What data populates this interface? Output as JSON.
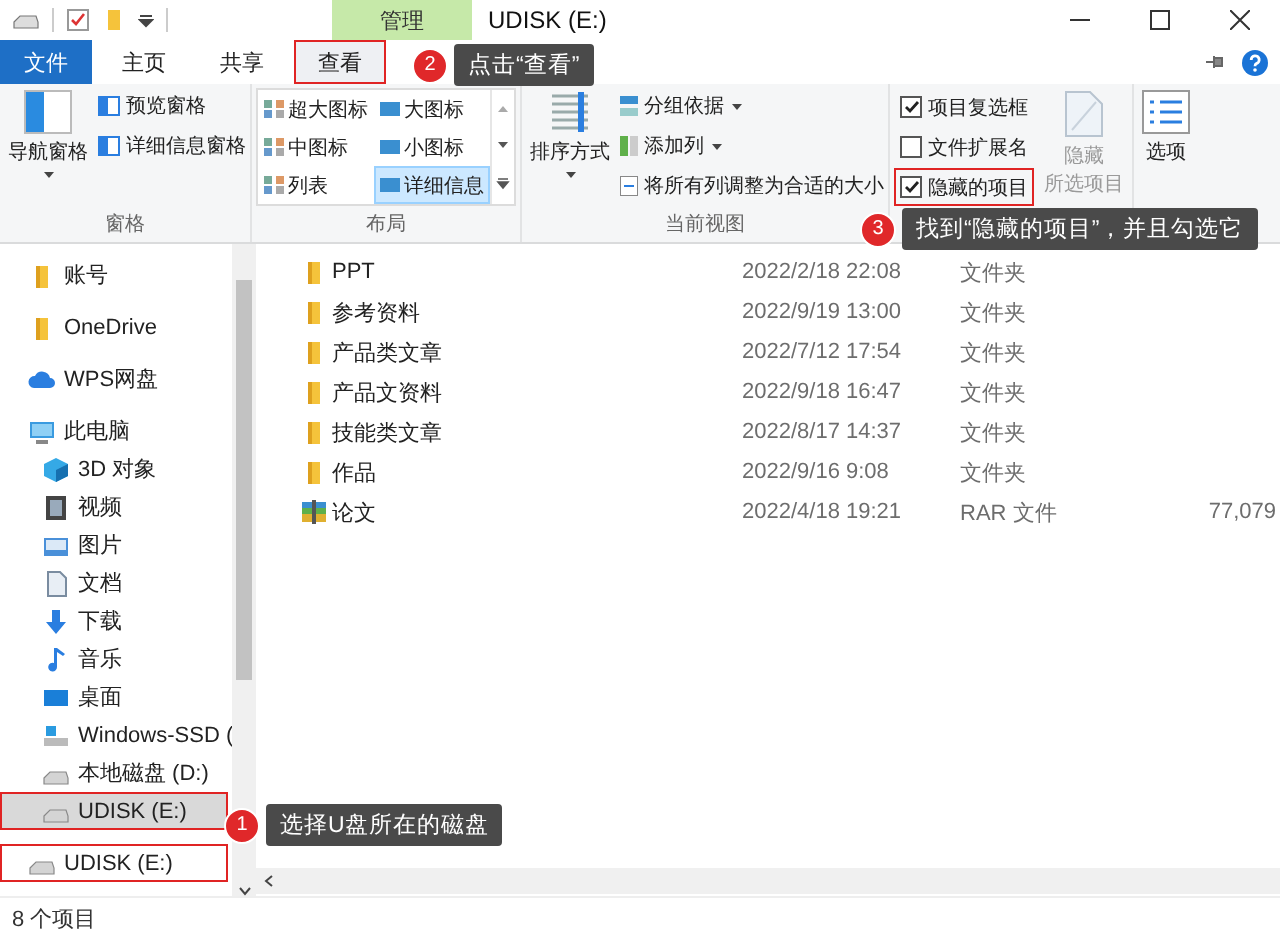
{
  "title_bar": {
    "context_tab": "管理",
    "title": "UDISK (E:)"
  },
  "ribbon_tabs": [
    {
      "label": "文件",
      "kind": "file",
      "selected": false,
      "highlighted": false
    },
    {
      "label": "主页",
      "kind": "tab",
      "selected": false,
      "highlighted": false
    },
    {
      "label": "共享",
      "kind": "tab",
      "selected": false,
      "highlighted": false
    },
    {
      "label": "查看",
      "kind": "tab",
      "selected": true,
      "highlighted": true
    }
  ],
  "ribbon": {
    "panes": {
      "label": "窗格",
      "navigation_pane": "导航窗格",
      "preview_pane": "预览窗格",
      "details_pane": "详细信息窗格"
    },
    "layout": {
      "label": "布局",
      "options": [
        {
          "label": "超大图标",
          "selected": false
        },
        {
          "label": "大图标",
          "selected": false
        },
        {
          "label": "中图标",
          "selected": false
        },
        {
          "label": "小图标",
          "selected": false
        },
        {
          "label": "列表",
          "selected": false
        },
        {
          "label": "详细信息",
          "selected": true
        }
      ]
    },
    "current_view": {
      "label": "当前视图",
      "sort_by": "排序方式",
      "group_by": "分组依据",
      "add_columns": "添加列",
      "size_columns": "将所有列调整为合适的大小"
    },
    "show_hide": {
      "checkboxes": [
        {
          "label": "项目复选框",
          "checked": true,
          "highlighted": false
        },
        {
          "label": "文件扩展名",
          "checked": false,
          "highlighted": false
        },
        {
          "label": "隐藏的项目",
          "checked": true,
          "highlighted": true
        }
      ],
      "hide_selected": {
        "lines": [
          "隐藏",
          "所选项目"
        ],
        "disabled": true
      }
    },
    "options": "选项"
  },
  "navigation": [
    {
      "label": "账号",
      "kind": "folder",
      "selected": false,
      "highlighted": false
    },
    {
      "label": "OneDrive",
      "kind": "folder",
      "selected": false,
      "highlighted": false
    },
    {
      "label": "WPS网盘",
      "kind": "cloud",
      "selected": false,
      "highlighted": false
    },
    {
      "label": "此电脑",
      "kind": "pc",
      "selected": false,
      "highlighted": false,
      "children": [
        {
          "label": "3D 对象",
          "kind": "cube",
          "selected": false,
          "highlighted": false
        },
        {
          "label": "视频",
          "kind": "video",
          "selected": false,
          "highlighted": false
        },
        {
          "label": "图片",
          "kind": "picture",
          "selected": false,
          "highlighted": false
        },
        {
          "label": "文档",
          "kind": "document",
          "selected": false,
          "highlighted": false
        },
        {
          "label": "下载",
          "kind": "download",
          "selected": false,
          "highlighted": false
        },
        {
          "label": "音乐",
          "kind": "music",
          "selected": false,
          "highlighted": false
        },
        {
          "label": "桌面",
          "kind": "desktop",
          "selected": false,
          "highlighted": false
        },
        {
          "label": "Windows-SSD (",
          "kind": "drive-windows",
          "selected": false,
          "highlighted": false
        },
        {
          "label": "本地磁盘 (D:)",
          "kind": "drive",
          "selected": false,
          "highlighted": false
        },
        {
          "label": "UDISK (E:)",
          "kind": "drive",
          "selected": true,
          "highlighted": true
        }
      ]
    },
    {
      "label": "UDISK (E:)",
      "kind": "drive",
      "selected": false,
      "highlighted": true
    }
  ],
  "files": [
    {
      "name": "PPT",
      "date": "2022/2/18 22:08",
      "type": "文件夹",
      "kind": "folder"
    },
    {
      "name": "参考资料",
      "date": "2022/9/19 13:00",
      "type": "文件夹",
      "kind": "folder"
    },
    {
      "name": "产品类文章",
      "date": "2022/7/12 17:54",
      "type": "文件夹",
      "kind": "folder"
    },
    {
      "name": "产品文资料",
      "date": "2022/9/18 16:47",
      "type": "文件夹",
      "kind": "folder"
    },
    {
      "name": "技能类文章",
      "date": "2022/8/17 14:37",
      "type": "文件夹",
      "kind": "folder"
    },
    {
      "name": "作品",
      "date": "2022/9/16 9:08",
      "type": "文件夹",
      "kind": "folder"
    },
    {
      "name": "论文",
      "date": "2022/4/18 19:21",
      "type": "RAR 文件",
      "size": "77,079",
      "kind": "rar"
    }
  ],
  "status_bar": "8 个项目",
  "annotations": [
    {
      "number": "2",
      "text": "点击“查看”"
    },
    {
      "number": "3",
      "text": "找到“隐藏的项目”，并且勾选它"
    },
    {
      "number": "1",
      "text": "选择U盘所在的磁盘"
    }
  ]
}
